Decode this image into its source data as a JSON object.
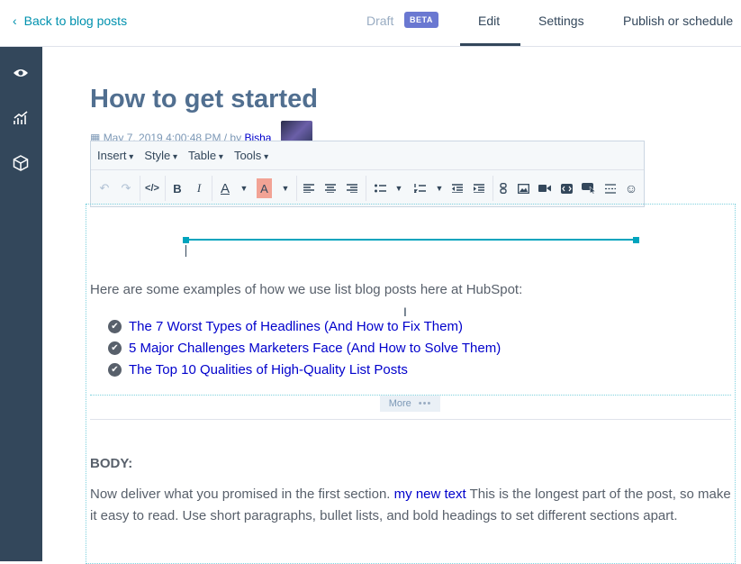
{
  "header": {
    "back_label": "Back to blog posts",
    "draft_label": "Draft",
    "beta_label": "BETA",
    "tabs": {
      "edit": "Edit",
      "settings": "Settings",
      "publish": "Publish or schedule"
    }
  },
  "sidebar": {
    "icons": [
      "eye-icon",
      "analytics-icon",
      "cube-icon"
    ]
  },
  "post": {
    "title": "How to get started",
    "date": "May 7, 2019 4:00:48 PM / by ",
    "author": "Bisha"
  },
  "toolbar": {
    "menus": {
      "insert": "Insert",
      "style": "Style",
      "table": "Table",
      "tools": "Tools"
    }
  },
  "content": {
    "intro": "Here are some examples of how we use list blog posts here at HubSpot:",
    "links": [
      "The 7 Worst Types of Headlines (And How to Fix Them)",
      "5 Major Challenges Marketers Face (And How to Solve Them)",
      "The Top 10 Qualities of High-Quality List Posts"
    ],
    "more_label": "More",
    "body_heading": "BODY:",
    "body_before": "Now deliver what you promised in the first section. ",
    "body_link": "my new text",
    "body_after": " This is the longest part of the post, so make it easy to read. Use short paragraphs, bullet lists, and bold headings to set different sections apart."
  },
  "colors": {
    "accent": "#00a4bd",
    "sidebar": "#33475b",
    "link": "#0000cc",
    "beta": "#6a78d1"
  }
}
